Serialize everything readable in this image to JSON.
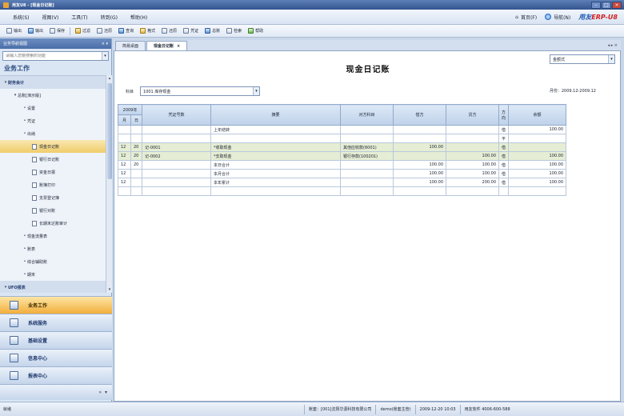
{
  "window": {
    "title": "用友U8 - [现金日记账]"
  },
  "menu": {
    "items": [
      "系统(S)",
      "视图(V)",
      "工具(T)",
      "转到(G)",
      "帮助(H)"
    ],
    "right": {
      "home": "首页(F)",
      "navigate": "导航(N)"
    },
    "brand": {
      "name": "用友",
      "product": "ERP-U8"
    }
  },
  "toolbar": {
    "tools": [
      "输出",
      "输出",
      "保存",
      "过滤",
      "还原",
      "查询",
      "格式",
      "还原",
      "凭证",
      "总账",
      "检索",
      "帮助"
    ]
  },
  "sidebar": {
    "header": "业务导航视图",
    "search_placeholder": "请输入您要搜索的功能",
    "title": "业务工作",
    "tree": [
      {
        "label": "财务会计",
        "level": 0
      },
      {
        "label": "总账[演示版]",
        "level": 1
      },
      {
        "label": "设置",
        "level": 2
      },
      {
        "label": "凭证",
        "level": 2
      },
      {
        "label": "出纳",
        "level": 2
      },
      {
        "label": "现金日记账",
        "level": 3,
        "selected": true
      },
      {
        "label": "银行日记账",
        "level": 3
      },
      {
        "label": "资金日报",
        "level": 3
      },
      {
        "label": "账簿打印",
        "level": 3
      },
      {
        "label": "支票登记簿",
        "level": 3
      },
      {
        "label": "银行对账",
        "level": 3
      },
      {
        "label": "长期未达账审计",
        "level": 3
      },
      {
        "label": "现金流量表",
        "level": 2
      },
      {
        "label": "账表",
        "level": 2
      },
      {
        "label": "综合辅助账",
        "level": 2
      },
      {
        "label": "期末",
        "level": 2
      },
      {
        "label": "UFO报表",
        "level": 0
      }
    ],
    "nav_buttons": [
      "业务工作",
      "系统服务",
      "基础设置",
      "信息中心",
      "报表中心"
    ],
    "nav_footer": "»"
  },
  "tabs": [
    {
      "label": "简易桌面",
      "active": false
    },
    {
      "label": "现金日记账",
      "active": true
    }
  ],
  "report": {
    "title": "现金日记账",
    "format": "金额式",
    "account_label": "科目",
    "account": "1001 库存现金",
    "period": "月份：2009.12-2009.12",
    "headers": {
      "year": "2009年",
      "month": "月",
      "day": "日",
      "voucher": "凭证号数",
      "summary": "摘要",
      "counter": "对方科目",
      "debit": "借方",
      "credit": "贷方",
      "direction": "方向",
      "balance": "余额"
    },
    "rows": [
      {
        "month": "",
        "day": "",
        "voucher": "",
        "summary": "上年结转",
        "counter": "",
        "debit": "",
        "credit": "",
        "direction": "借",
        "balance": "100.00",
        "hl": false
      },
      {
        "month": "",
        "day": "",
        "voucher": "",
        "summary": "",
        "counter": "",
        "debit": "",
        "credit": "",
        "direction": "平",
        "balance": "",
        "hl": false
      },
      {
        "month": "12",
        "day": "20",
        "voucher": "记-0001",
        "summary": "*收取现金",
        "counter": "其他应收款(6001)",
        "debit": "100.00",
        "credit": "",
        "direction": "借",
        "balance": "",
        "hl": true
      },
      {
        "month": "12",
        "day": "20",
        "voucher": "记-0002",
        "summary": "*支取现金",
        "counter": "银行存款(100201)",
        "debit": "",
        "credit": "100.00",
        "direction": "借",
        "balance": "100.00",
        "hl": true
      },
      {
        "month": "12",
        "day": "20",
        "voucher": "",
        "summary": "本日合计",
        "counter": "",
        "debit": "100.00",
        "credit": "100.00",
        "direction": "借",
        "balance": "100.00",
        "hl": false
      },
      {
        "month": "12",
        "day": "",
        "voucher": "",
        "summary": "本月合计",
        "counter": "",
        "debit": "100.00",
        "credit": "100.00",
        "direction": "借",
        "balance": "100.00",
        "hl": false
      },
      {
        "month": "12",
        "day": "",
        "voucher": "",
        "summary": "本年累计",
        "counter": "",
        "debit": "100.00",
        "credit": "200.00",
        "direction": "借",
        "balance": "100.00",
        "hl": false
      }
    ]
  },
  "status": {
    "left": "就绪",
    "company": "账套：[001]沈阳华源科技有限公司",
    "user": "demo(账套主管)",
    "date": "2009-12-20 10:03",
    "support": "用友软件 4006-600-588"
  }
}
